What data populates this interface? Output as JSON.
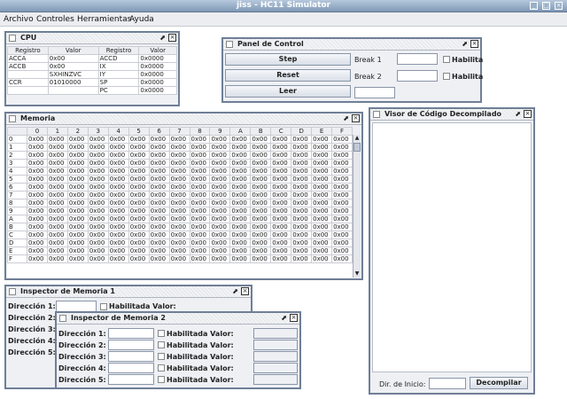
{
  "window": {
    "title": "jiss - HC11 Simulator"
  },
  "menu": [
    "Archivo",
    "Controles",
    "Herramientas",
    "Ayuda"
  ],
  "cpu": {
    "title": "CPU",
    "headers": [
      "Registro",
      "Valor",
      "Registro",
      "Valor"
    ],
    "rows": [
      [
        "ACCA",
        "0x00",
        "ACCD",
        "0x0000"
      ],
      [
        "ACCB",
        "0x00",
        "IX",
        "0x0000"
      ],
      [
        "",
        "SXHINZVC",
        "IY",
        "0x0000"
      ],
      [
        "CCR",
        "01010000",
        "SP",
        "0x0000"
      ],
      [
        "",
        "",
        "PC",
        "0x0000"
      ]
    ]
  },
  "panel": {
    "title": "Panel de Control",
    "step": "Step",
    "reset": "Reset",
    "leer": "Leer",
    "break1": "Break 1",
    "break2": "Break 2",
    "habilita": "Habilita"
  },
  "memoria": {
    "title": "Memoria",
    "cols": [
      "0",
      "1",
      "2",
      "3",
      "4",
      "5",
      "6",
      "7",
      "8",
      "9",
      "A",
      "B",
      "C",
      "D",
      "E",
      "F"
    ],
    "rows": [
      "0",
      "1",
      "2",
      "3",
      "4",
      "5",
      "6",
      "7",
      "8",
      "9",
      "A",
      "B",
      "C",
      "D",
      "E",
      "F"
    ],
    "cell": "0x00"
  },
  "visor": {
    "title": "Visor de Código Decompilado",
    "dir_label": "Dir. de Inicio:",
    "decompilar": "Decompilar"
  },
  "insp1": {
    "title": "Inspector de Memoria 1",
    "labels": [
      "Dirección 1:",
      "Dirección 2:",
      "Dirección 3:",
      "Dirección 4:",
      "Dirección 5:"
    ],
    "hab": "Habilitada Valor:"
  },
  "insp2": {
    "title": "Inspector de Memoria 2",
    "labels": [
      "Dirección 1:",
      "Dirección 2:",
      "Dirección 3:",
      "Dirección 4:",
      "Dirección 5:"
    ],
    "hab": "Habilitada Valor:"
  }
}
